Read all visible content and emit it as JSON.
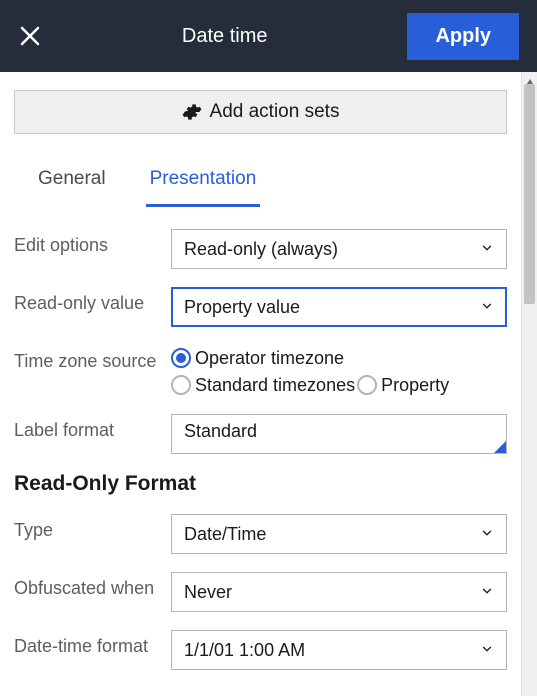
{
  "header": {
    "title": "Date time",
    "apply": "Apply"
  },
  "addBar": {
    "label": "Add action sets"
  },
  "tabs": {
    "general": "General",
    "presentation": "Presentation",
    "active": "presentation"
  },
  "fields": {
    "editOptions": {
      "label": "Edit options",
      "value": "Read-only (always)"
    },
    "readOnlyValue": {
      "label": "Read-only value",
      "value": "Property value"
    },
    "timezoneSource": {
      "label": "Time zone source",
      "options": {
        "operator": "Operator timezone",
        "standard": "Standard timezones",
        "property": "Property"
      },
      "selected": "operator"
    },
    "labelFormat": {
      "label": "Label format",
      "value": "Standard"
    },
    "sectionTitle": "Read-Only Format",
    "type": {
      "label": "Type",
      "value": "Date/Time"
    },
    "obfuscated": {
      "label": "Obfuscated when",
      "value": "Never"
    },
    "dateTimeFormat": {
      "label": "Date-time format",
      "value": "1/1/01 1:00 AM"
    }
  }
}
